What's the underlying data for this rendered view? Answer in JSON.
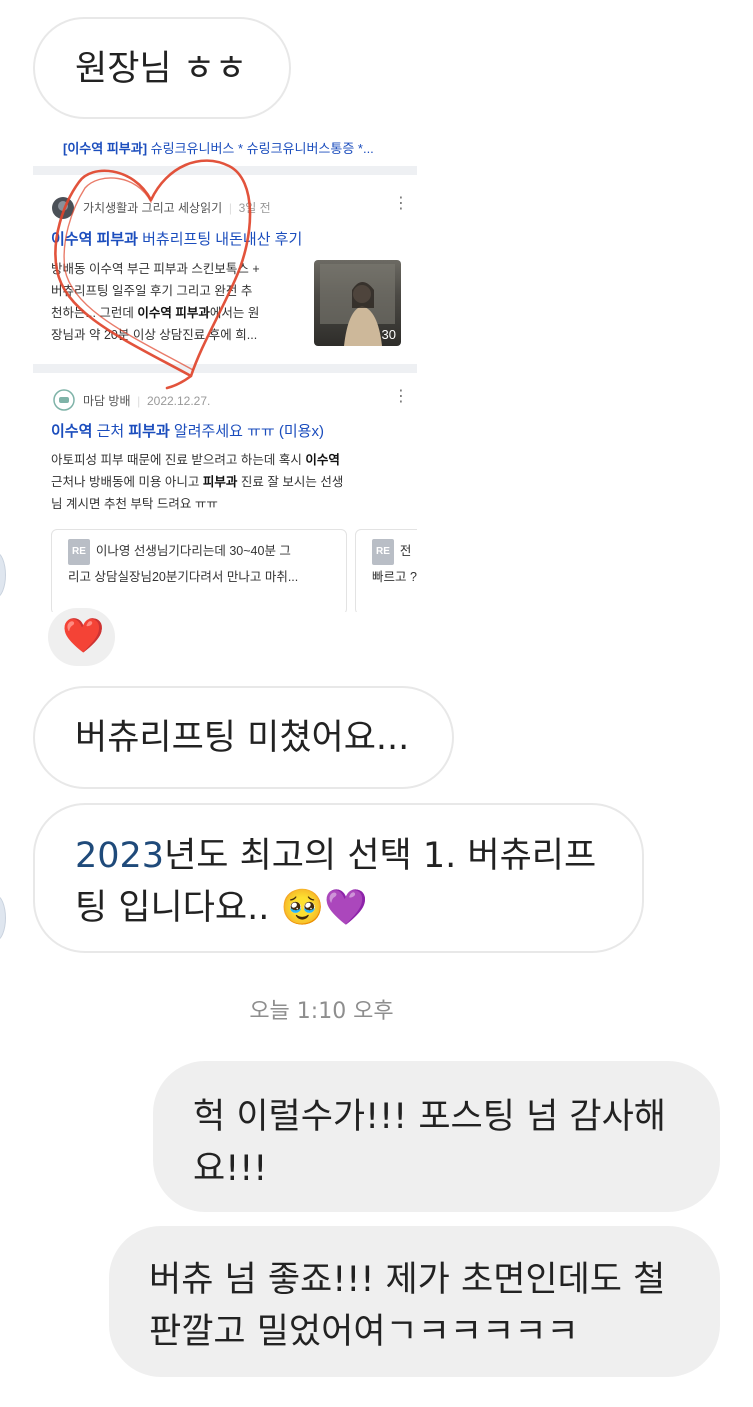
{
  "messages": {
    "m1": "원장님 ㅎㅎ",
    "m2": "버츄리프팅 미쳤어요...",
    "m3_num": "2023",
    "m3_line1_rest": "년도 최고의 선택 1. 버츄리프",
    "m3_line2": "팅 입니다요.. ",
    "m3_emojis": "🥹💜",
    "m4_line1": "헉 이럴수가!!!  포스팅 넘 감사해",
    "m4_line2": "요!!!",
    "m5_line1": "버츄 넘 좋죠!!!  제가 초면인데도 철",
    "m5_line2": "판깔고 밀었어여ㄱㅋㅋㅋㅋㅋ"
  },
  "reaction": "❤️",
  "timestamp": "오늘 1:10 오후",
  "shared": {
    "topline_bold": "[이수역 피부과]",
    "topline_rest": " 슈링크유니버스 * 슈링크유니버스통증 *...",
    "post1": {
      "author": "가치생활과 그리고 세상읽기",
      "date": "3일 전",
      "title_bold": "이수역 피부과",
      "title_rest": " 버츄리프팅 내돈내산 후기",
      "body1": "방배동 이수역 부근 피부과 스킨보톡스 +",
      "body2": "버츄리프팅 일주일 후기 그리고 완전 추",
      "body3a": "천하는... 그런데 ",
      "body3b": "이수역 피부과",
      "body3c": "에서는 원",
      "body4": "장님과 약 20분 이상 상담진료 후에 희...",
      "thumb_count": "30"
    },
    "post2": {
      "author": "마담 방배",
      "date": "2022.12.27.",
      "title_bold1": "이수역",
      "title_mid": " 근처 ",
      "title_bold2": "피부과",
      "title_rest": " 알려주세요 ㅠㅠ (미용x)",
      "body1a": "아토피성 피부 때문에 진료 받으려고 하는데 혹시 ",
      "body1b": "이수역",
      "body2a": "근처나 방배동에 미용 아니고 ",
      "body2b": "피부과",
      "body2c": " 진료 잘 보시는 선생",
      "body3": "님 계시면 추천 부탁 드려요 ㅠㅠ",
      "reply_badge": "RE",
      "reply1_l1": "이나영 선생님기다리는데 30~40분 그",
      "reply1_l2": "리고 상담실장님20분기다려서 만나고 마취...",
      "reply2_l1": "전",
      "reply2_l2": "빠르고 ?"
    }
  },
  "colors": {
    "incoming_bubble": "#ffffff",
    "outgoing_bubble": "#efefef",
    "link_blue": "#1b4dbd",
    "heart_annotation": "#e0442b"
  }
}
